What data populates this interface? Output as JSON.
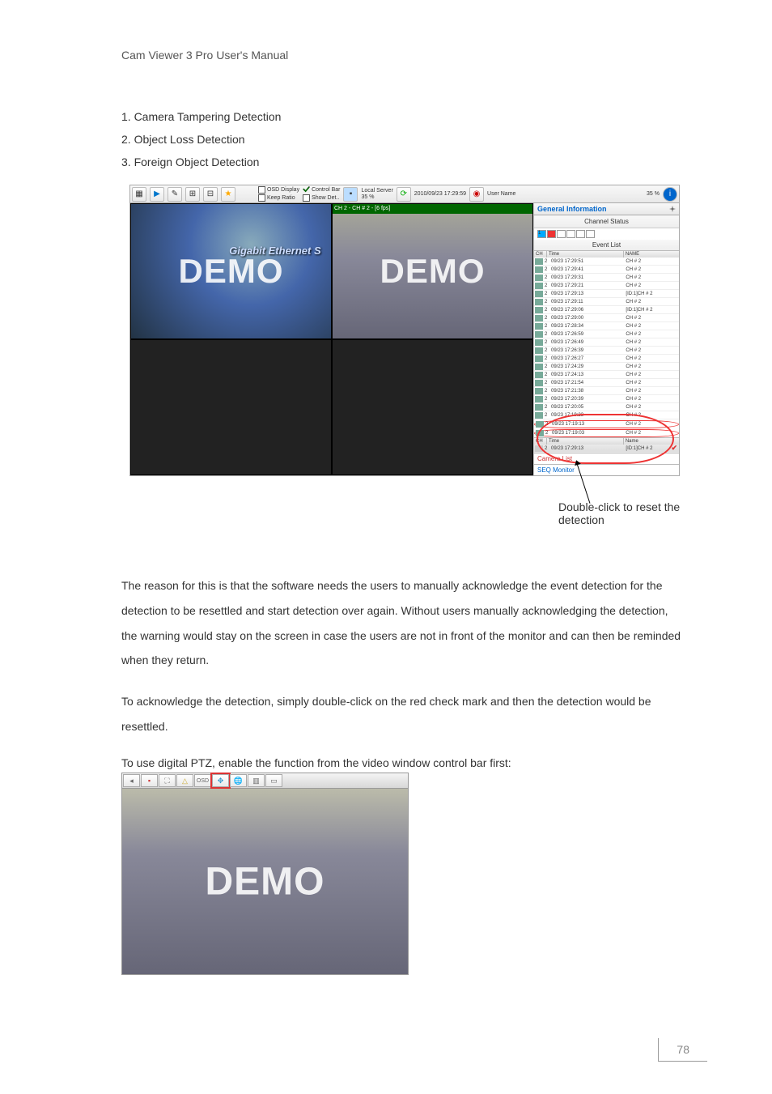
{
  "header": "Cam  Viewer  3  Pro  User's  Manual",
  "items": [
    "1. Camera Tampering Detection",
    "2. Object Loss Detection",
    "3. Foreign Object Detection"
  ],
  "toolbar": {
    "osd_display": "OSD Display",
    "keep_ratio": "Keep Ratio",
    "control_bar": "Control Bar",
    "show_det": "Show Det..",
    "local_server": "Local Server",
    "percent_a": "35 %",
    "datetime": "2010/09/23 17:29:59",
    "user_name": "User Name",
    "percent_b": "35 %"
  },
  "tile_header": "CH 2 - CH # 2 - [6 fps]",
  "gigabit": "Gigabit Ethernet S",
  "demo": "DEMO",
  "panel": {
    "title": "General Information",
    "channel_status": "Channel Status",
    "event_list": "Event List",
    "ch": "CH",
    "time": "Time",
    "name": "NAME",
    "name2": "Name",
    "camera_list": "Camera List",
    "seq_monitor": "SEQ Monitor"
  },
  "events": [
    {
      "ch": "2",
      "time": "09/23 17:29:51",
      "name": "CH # 2"
    },
    {
      "ch": "2",
      "time": "09/23 17:29:41",
      "name": "CH # 2"
    },
    {
      "ch": "2",
      "time": "09/23 17:29:31",
      "name": "CH # 2"
    },
    {
      "ch": "2",
      "time": "09/23 17:29:21",
      "name": "CH # 2"
    },
    {
      "ch": "2",
      "time": "09/23 17:29:13",
      "name": "[ID:1]CH # 2"
    },
    {
      "ch": "2",
      "time": "09/23 17:29:11",
      "name": "CH # 2"
    },
    {
      "ch": "2",
      "time": "09/23 17:29:06",
      "name": "[ID:1]CH # 2"
    },
    {
      "ch": "2",
      "time": "09/23 17:29:00",
      "name": "CH # 2"
    },
    {
      "ch": "2",
      "time": "09/23 17:28:34",
      "name": "CH # 2"
    },
    {
      "ch": "2",
      "time": "09/23 17:26:59",
      "name": "CH # 2"
    },
    {
      "ch": "2",
      "time": "09/23 17:26:49",
      "name": "CH # 2"
    },
    {
      "ch": "2",
      "time": "09/23 17:26:39",
      "name": "CH # 2"
    },
    {
      "ch": "2",
      "time": "09/23 17:26:27",
      "name": "CH # 2"
    },
    {
      "ch": "2",
      "time": "09/23 17:24:29",
      "name": "CH # 2"
    },
    {
      "ch": "2",
      "time": "09/23 17:24:13",
      "name": "CH # 2"
    },
    {
      "ch": "2",
      "time": "09/23 17:21:54",
      "name": "CH # 2"
    },
    {
      "ch": "2",
      "time": "09/23 17:21:38",
      "name": "CH # 2"
    },
    {
      "ch": "2",
      "time": "09/23 17:20:39",
      "name": "CH # 2"
    },
    {
      "ch": "2",
      "time": "09/23 17:20:05",
      "name": "CH # 2"
    },
    {
      "ch": "2",
      "time": "09/23 17:19:23",
      "name": "CH # 2"
    },
    {
      "ch": "2",
      "time": "09/23 17:19:13",
      "name": "CH # 2"
    },
    {
      "ch": "2",
      "time": "09/23 17:19:03",
      "name": "CH # 2"
    }
  ],
  "highlight_event": {
    "ch": "2",
    "time": "09/23 17:29:13",
    "name": "[ID:1]CH # 2"
  },
  "callout": "Double-click to reset the detection",
  "para1": "The reason for this is that the software needs the users to manually acknowledge the event detection for the detection to be resettled and start detection over again. Without users manually acknowledging the detection, the warning would stay on the screen in case the users are not in front of the monitor and can then be reminded when they return.",
  "para2": "To acknowledge the detection, simply double-click on the red check mark and then the detection would be resettled.",
  "para3": "To use digital PTZ, enable the function from the video window control bar first:",
  "ptz_osd": "OSD",
  "page_number": "78"
}
